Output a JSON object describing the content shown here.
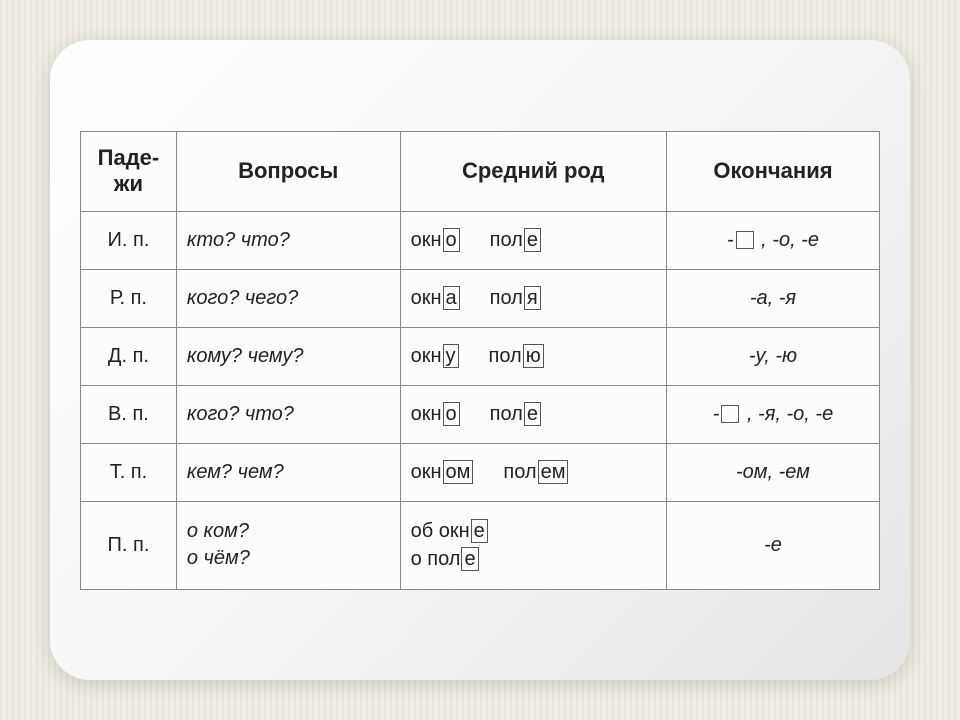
{
  "headers": {
    "cases": "Паде-\nжи",
    "questions": "Вопросы",
    "neuter": "Средний  род",
    "endings": "Окончания"
  },
  "rows": [
    {
      "case": "И.  п.",
      "question": "кто? что?",
      "w1stem": "окн",
      "w1end": "о",
      "w2stem": "пол",
      "w2end": "е",
      "ending_pre": "-",
      "ending_box": true,
      "ending_post": " , -о, -е"
    },
    {
      "case": "Р.  п.",
      "question": "кого? чего?",
      "w1stem": "окн",
      "w1end": "а",
      "w2stem": "пол",
      "w2end": "я",
      "ending": "-а, -я"
    },
    {
      "case": "Д.  п.",
      "question": "кому? чему?",
      "w1stem": "окн",
      "w1end": "у",
      "w2stem": "пол",
      "w2end": "ю",
      "ending": "-у, -ю"
    },
    {
      "case": "В.  п.",
      "question": "кого? что?",
      "w1stem": "окн",
      "w1end": "о",
      "w2stem": "пол",
      "w2end": "е",
      "ending_pre": "-",
      "ending_box": true,
      "ending_post": " , -я, -о, -е"
    },
    {
      "case": "Т.  п.",
      "question": "кем? чем?",
      "w1stem": "окн",
      "w1end": "ом",
      "w2stem": "пол",
      "w2end": "ем",
      "ending": "-ом, -ем"
    },
    {
      "case": "П.  п.",
      "question_l1": "о ком?",
      "question_l2": "о чём?",
      "w1pre": "об  ",
      "w1stem": "окн",
      "w1end": "е",
      "w2pre": "о  ",
      "w2stem": "пол",
      "w2end": "е",
      "ending": "-е"
    }
  ]
}
